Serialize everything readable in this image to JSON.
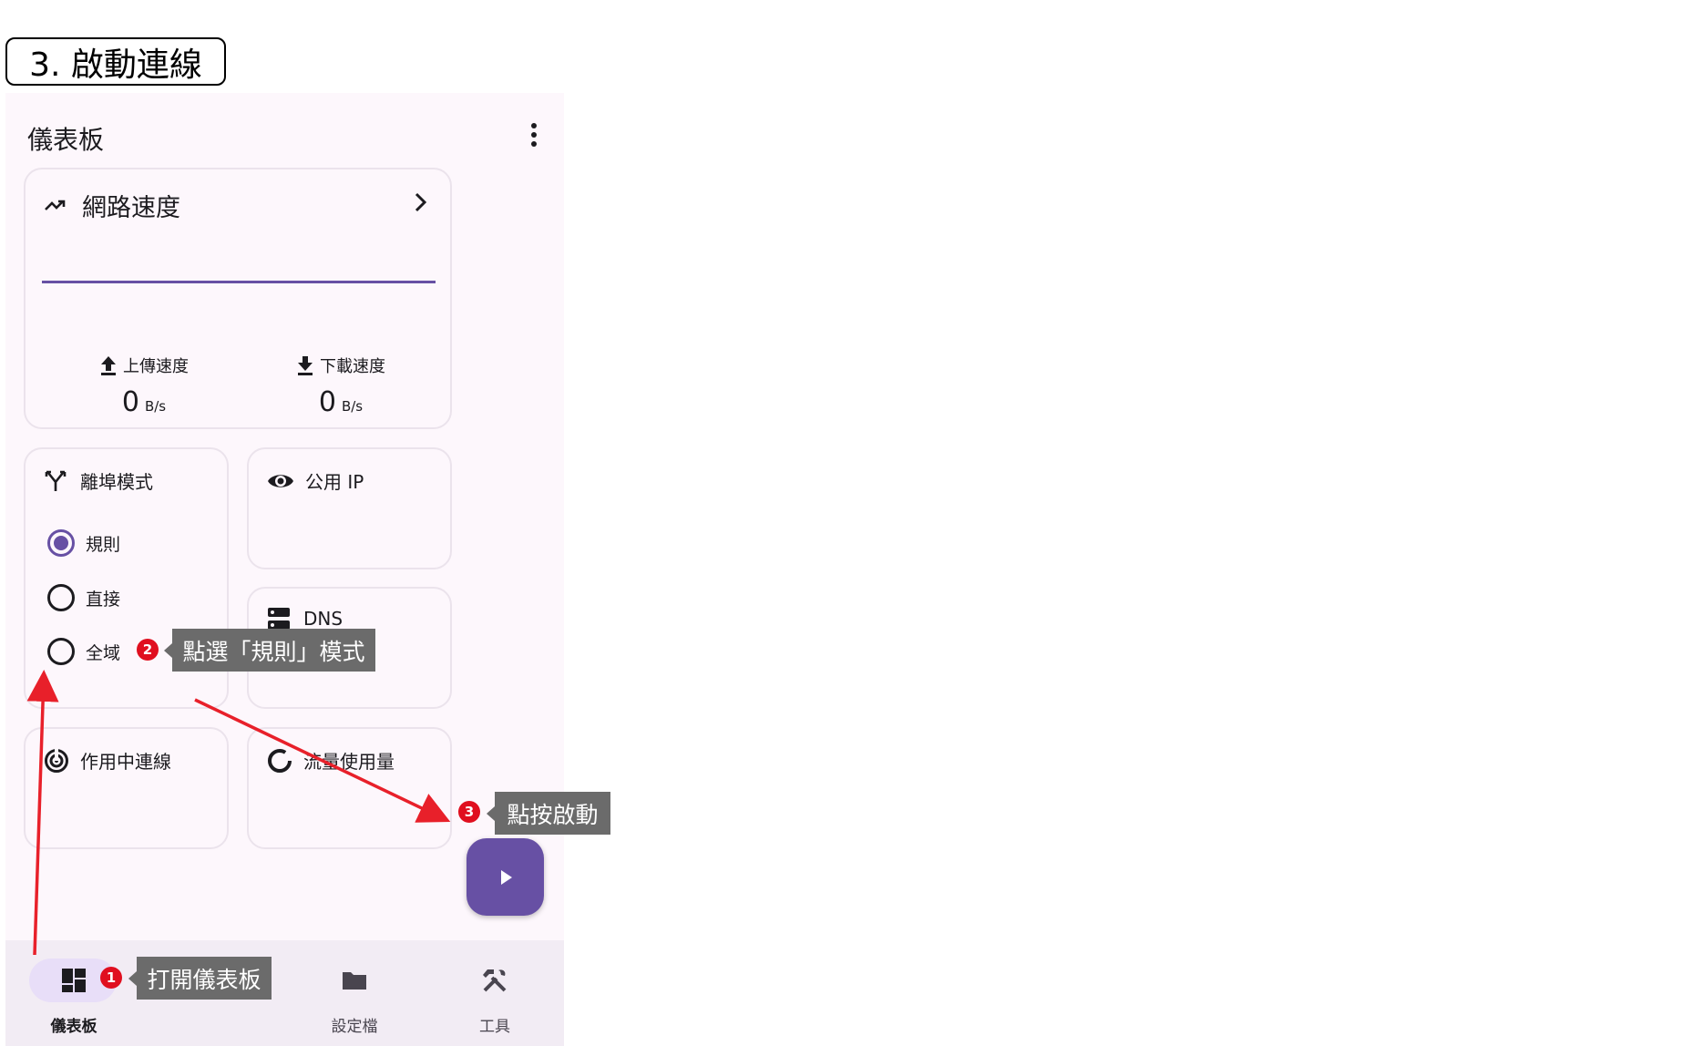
{
  "step_title": "3. 啟動連線",
  "appbar": {
    "title": "儀表板"
  },
  "speed_card": {
    "title": "網路速度",
    "upload_label": "上傳速度",
    "upload_value": "0",
    "upload_unit": "B/s",
    "download_label": "下載速度",
    "download_value": "0",
    "download_unit": "B/s"
  },
  "mode_card": {
    "title": "離埠模式",
    "options": [
      {
        "label": "規則",
        "selected": true
      },
      {
        "label": "直接",
        "selected": false
      },
      {
        "label": "全域",
        "selected": false
      }
    ]
  },
  "ip_card": {
    "title": "公用 IP"
  },
  "dns_card": {
    "title": "DNS"
  },
  "connections_card": {
    "title": "作用中連線"
  },
  "traffic_card": {
    "title": "流量使用量"
  },
  "nav": [
    {
      "label": "儀表板",
      "active": true
    },
    {
      "label": "設定檔",
      "active": false
    },
    {
      "label": "工具",
      "active": false
    }
  ],
  "annotations": [
    {
      "number": "1",
      "text": "打開儀表板"
    },
    {
      "number": "2",
      "text": "點選「規則」模式"
    },
    {
      "number": "3",
      "text": "點按啟動"
    }
  ],
  "colors": {
    "accent": "#6750a4",
    "callout_bg": "#6b6b6b",
    "badge": "#e00f1f",
    "arrow": "#e8202a"
  }
}
